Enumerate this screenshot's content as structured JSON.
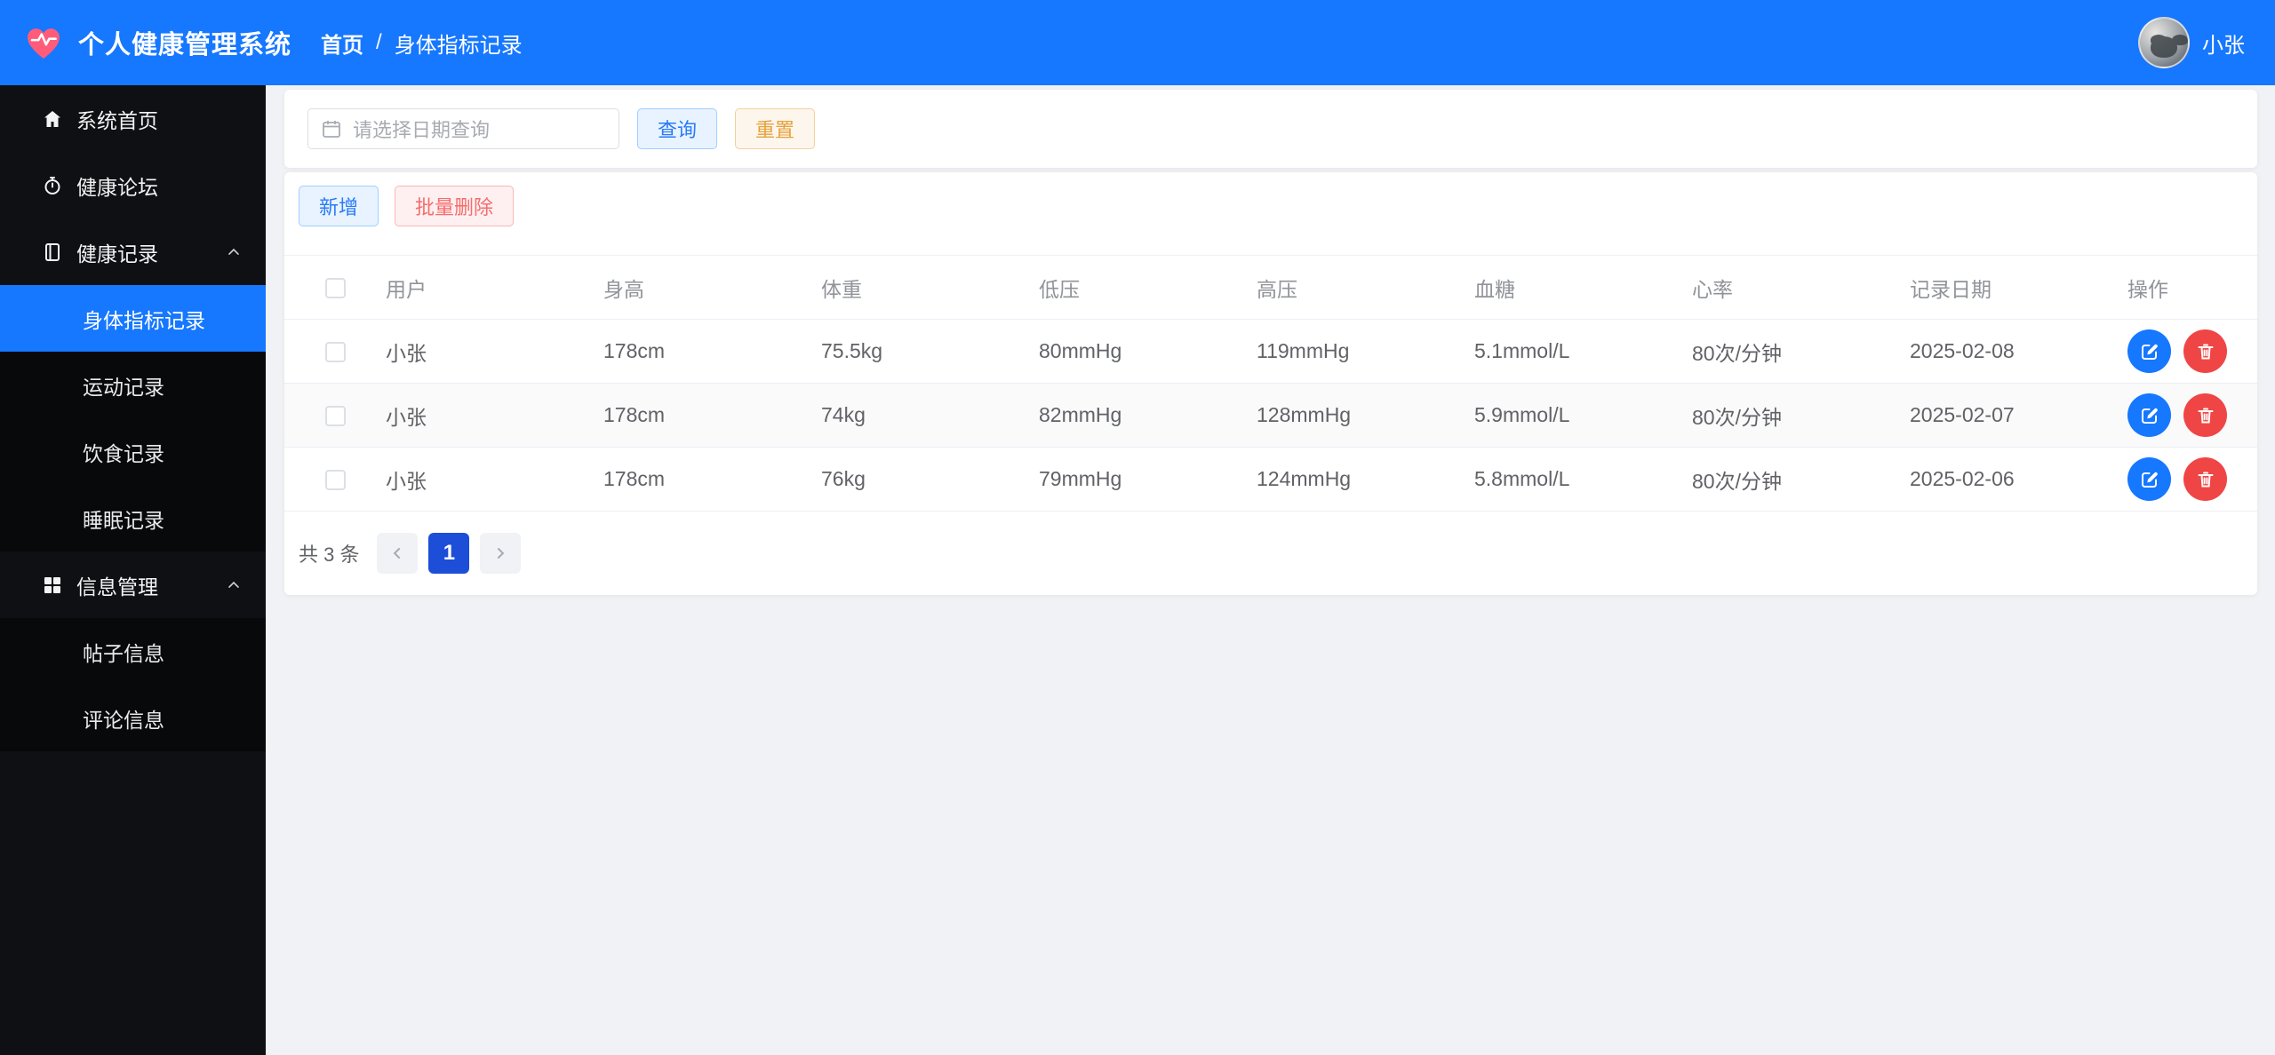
{
  "header": {
    "app_title": "个人健康管理系统",
    "breadcrumb": {
      "home": "首页",
      "separator": "/",
      "current": "身体指标记录"
    },
    "user_name": "小张"
  },
  "sidebar": {
    "home": "系统首页",
    "forum": "健康论坛",
    "records_group": "健康记录",
    "records_children": [
      "身体指标记录",
      "运动记录",
      "饮食记录",
      "睡眠记录"
    ],
    "active_item": "身体指标记录",
    "info_group": "信息管理",
    "info_children": [
      "帖子信息",
      "评论信息"
    ]
  },
  "search": {
    "date_placeholder": "请选择日期查询",
    "query_label": "查询",
    "reset_label": "重置"
  },
  "toolbar": {
    "add_label": "新增",
    "batch_delete_label": "批量删除"
  },
  "table": {
    "columns": [
      "用户",
      "身高",
      "体重",
      "低压",
      "高压",
      "血糖",
      "心率",
      "记录日期",
      "操作"
    ],
    "rows": [
      {
        "user": "小张",
        "height": "178cm",
        "weight": "75.5kg",
        "low_pressure": "80mmHg",
        "high_pressure": "119mmHg",
        "blood_sugar": "5.1mmol/L",
        "heart_rate": "80次/分钟",
        "record_date": "2025-02-08"
      },
      {
        "user": "小张",
        "height": "178cm",
        "weight": "74kg",
        "low_pressure": "82mmHg",
        "high_pressure": "128mmHg",
        "blood_sugar": "5.9mmol/L",
        "heart_rate": "80次/分钟",
        "record_date": "2025-02-07"
      },
      {
        "user": "小张",
        "height": "178cm",
        "weight": "76kg",
        "low_pressure": "79mmHg",
        "high_pressure": "124mmHg",
        "blood_sugar": "5.8mmol/L",
        "heart_rate": "80次/分钟",
        "record_date": "2025-02-06"
      }
    ]
  },
  "pagination": {
    "total_text": "共 3 条",
    "current_page": "1"
  },
  "colors": {
    "header_blue": "#1677ff",
    "sidebar_bg": "#0e1013",
    "active_menu_blue": "#1677ff",
    "edit_button_blue": "#1677ff",
    "delete_button_red": "#f04545",
    "pagination_active": "#1d4ed8",
    "primary_plain_text": "#2a7bf6",
    "warning_text": "#e6a23c",
    "danger_text": "#f56c6c",
    "content_bg": "#f0f2f5"
  }
}
